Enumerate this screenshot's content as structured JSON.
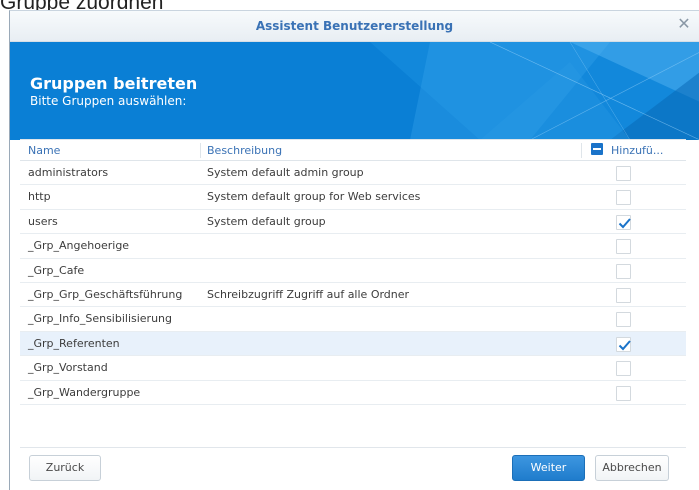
{
  "background_title": "Gruppe zuordnen",
  "window": {
    "title": "Assistent Benutzererstellung",
    "close_icon": "close-icon"
  },
  "banner": {
    "title": "Gruppen beitreten",
    "subtitle": "Bitte Gruppen auswählen:",
    "color": "#0a7fd5"
  },
  "table": {
    "headers": {
      "name": "Name",
      "description": "Beschreibung",
      "add": "Hinzufü..."
    },
    "rows": [
      {
        "name": "administrators",
        "description": "System default admin group",
        "checked": false
      },
      {
        "name": "http",
        "description": "System default group for Web services",
        "checked": false
      },
      {
        "name": "users",
        "description": "System default group",
        "checked": true
      },
      {
        "name": "_Grp_Angehoerige",
        "description": "",
        "checked": false
      },
      {
        "name": "_Grp_Cafe",
        "description": "",
        "checked": false
      },
      {
        "name": "_Grp_Grp_Geschäftsführung",
        "description": "Schreibzugriff Zugriff auf alle Ordner",
        "checked": false
      },
      {
        "name": "_Grp_Info_Sensibilisierung",
        "description": "",
        "checked": false
      },
      {
        "name": "_Grp_Referenten",
        "description": "",
        "checked": true,
        "selected": true
      },
      {
        "name": "_Grp_Vorstand",
        "description": "",
        "checked": false
      },
      {
        "name": "_Grp_Wandergruppe",
        "description": "",
        "checked": false
      }
    ]
  },
  "buttons": {
    "back": "Zurück",
    "next": "Weiter",
    "cancel": "Abbrechen"
  },
  "colors": {
    "accent": "#1a73c9",
    "selected_row": "#e8f1fb",
    "header_text": "#3a72b5"
  }
}
